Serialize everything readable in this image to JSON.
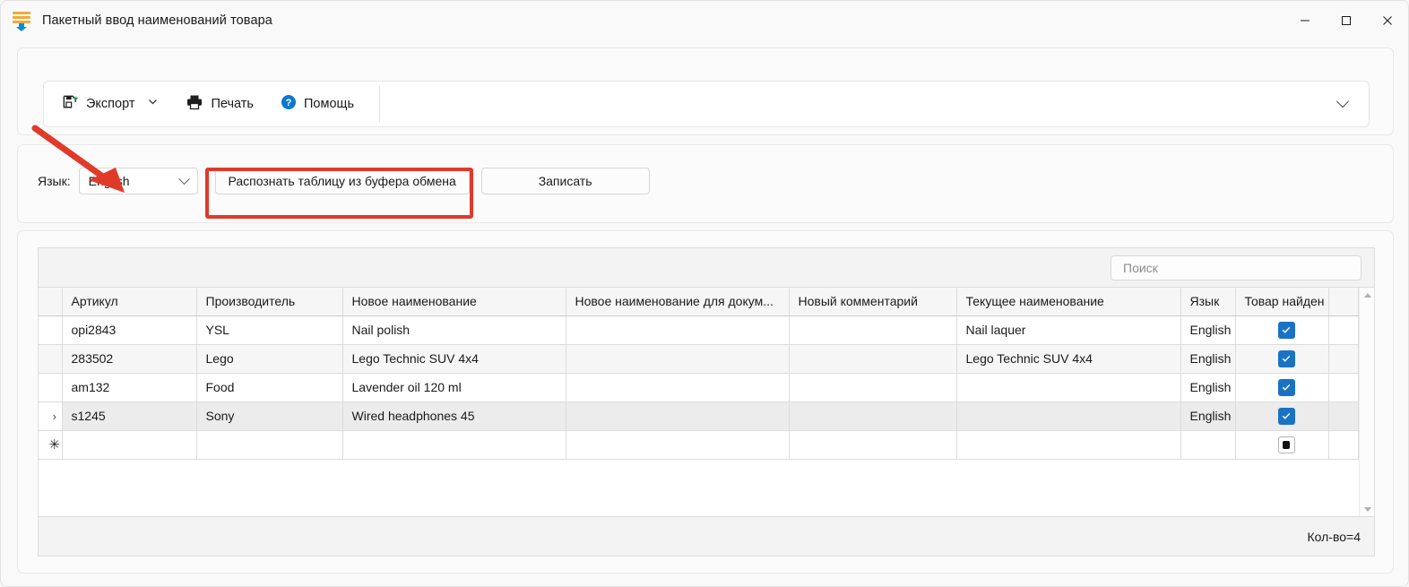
{
  "window": {
    "title": "Пакетный ввод наименований товара",
    "app_icon": "batch-import-icon",
    "controls": {
      "minimize": "minimize-icon",
      "maximize": "maximize-icon",
      "close": "close-icon"
    }
  },
  "toolbar": {
    "export_label": "Экспорт",
    "export_icon": "save-export-icon",
    "export_dropdown_icon": "chevron-down-icon",
    "print_label": "Печать",
    "print_icon": "printer-icon",
    "help_label": "Помощь",
    "help_icon": "help-circle-icon",
    "expand_icon": "chevron-down-icon"
  },
  "language_bar": {
    "label": "Язык:",
    "selected_language": "English",
    "dropdown_icon": "chevron-down-icon",
    "recognize_button": "Распознать таблицу из буфера обмена",
    "write_button": "Записать",
    "highlight_color": "#e03a2a",
    "annotation_arrow": "red-arrow-pointing-to-language-dropdown"
  },
  "grid": {
    "search_placeholder": "Поиск",
    "search_value": "",
    "status": "Кол-во=4",
    "columns": [
      "Артикул",
      "Производитель",
      "Новое наименование",
      "Новое наименование для докум...",
      "Новый комментарий",
      "Текущее наименование",
      "Язык",
      "Товар найден"
    ],
    "rows": [
      {
        "indicator": "",
        "article": "opi2843",
        "manufacturer": "YSL",
        "new_name": "Nail polish",
        "new_name_doc": "",
        "new_comment": "",
        "current_name": "Nail laquer",
        "language": "English",
        "found": "checked"
      },
      {
        "indicator": "",
        "article": "283502",
        "manufacturer": "Lego",
        "new_name": "Lego Technic SUV 4x4",
        "new_name_doc": "",
        "new_comment": "",
        "current_name": "Lego Technic SUV 4x4",
        "language": "English",
        "found": "checked"
      },
      {
        "indicator": "",
        "article": "am132",
        "manufacturer": "Food",
        "new_name": "Lavender oil 120 ml",
        "new_name_doc": "",
        "new_comment": "",
        "current_name": "",
        "language": "English",
        "found": "checked"
      },
      {
        "indicator": "›",
        "article": "s1245",
        "manufacturer": "Sony",
        "new_name": "Wired headphones 45",
        "new_name_doc": "",
        "new_comment": "",
        "current_name": "",
        "language": "English",
        "found": "checked"
      },
      {
        "indicator": "✳",
        "article": "",
        "manufacturer": "",
        "new_name": "",
        "new_name_doc": "",
        "new_comment": "",
        "current_name": "",
        "language": "",
        "found": "indeterminate"
      }
    ],
    "scrollbar": {
      "up_icon": "triangle-up-icon",
      "down_icon": "triangle-down-icon"
    }
  },
  "colors": {
    "accent_blue": "#1a72c4",
    "help_blue": "#0b78d0",
    "export_green": "#1aa34a",
    "icon_orange": "#f0a93b",
    "highlight_red": "#e03a2a"
  }
}
